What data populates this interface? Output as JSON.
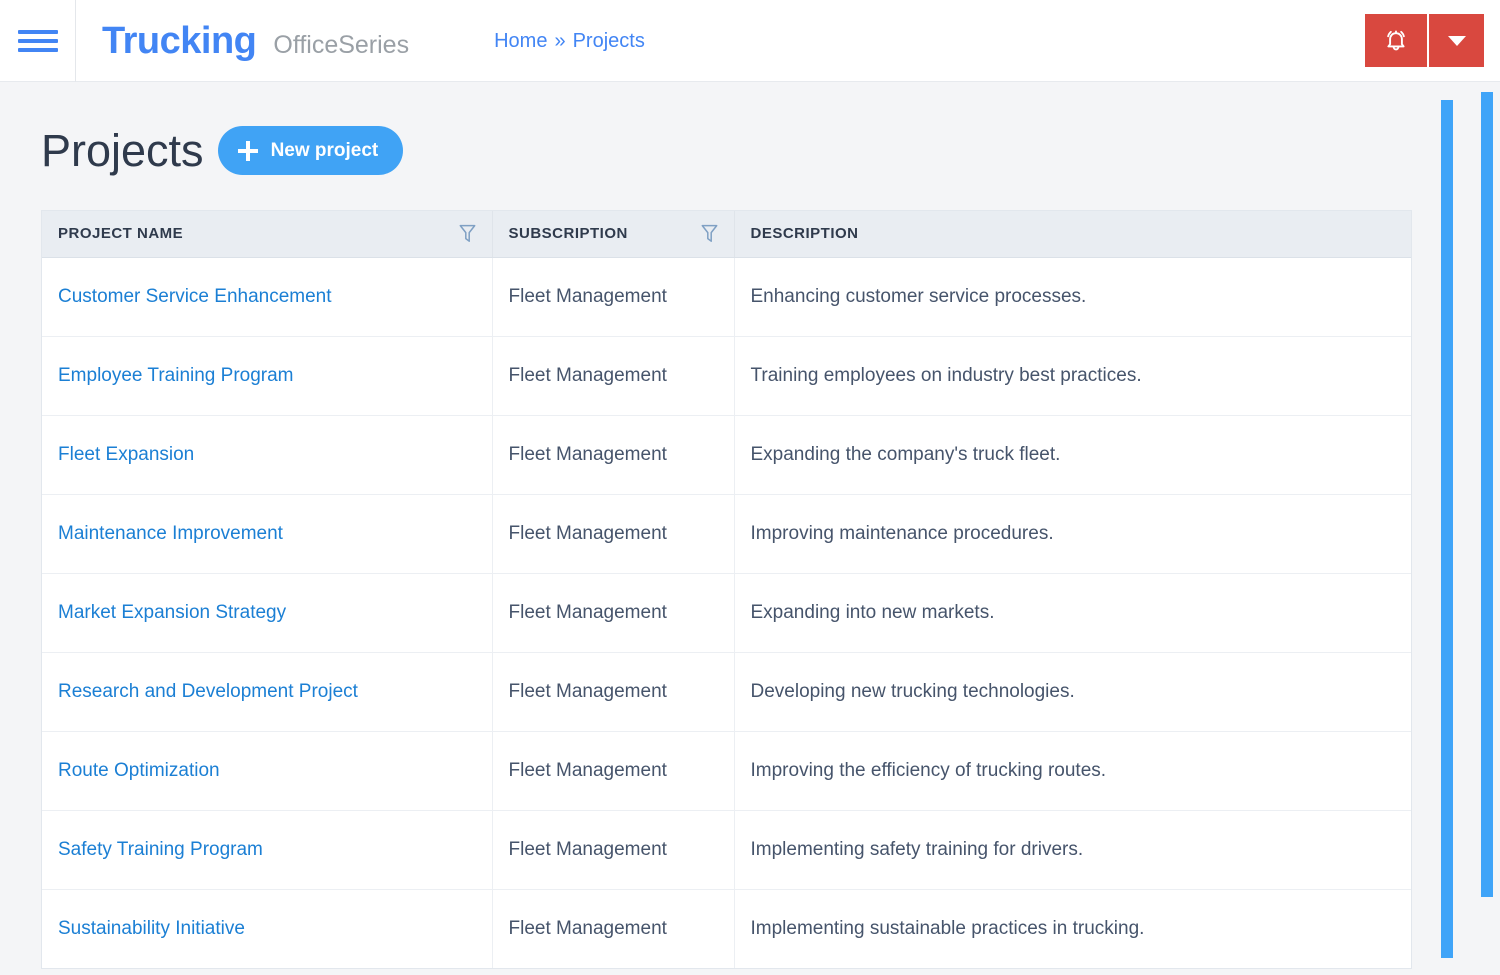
{
  "navbar": {
    "menu_icon": "hamburger-icon",
    "brand": "Trucking",
    "brand_sub": "OfficeSeries",
    "breadcrumb": {
      "home": "Home",
      "separator": "»",
      "current": "Projects"
    },
    "notification_icon": "bell-icon",
    "dropdown_icon": "chevron-down-icon",
    "accent_red": "#d9483f",
    "accent_blue": "#4285f4"
  },
  "page": {
    "title": "Projects",
    "new_project_label": "New project",
    "new_project_icon": "plus-icon",
    "primary_button_color": "#40a3f5"
  },
  "table": {
    "columns": [
      {
        "label": "PROJECT NAME",
        "filter_icon": "filter-icon",
        "filterable": true
      },
      {
        "label": "SUBSCRIPTION",
        "filter_icon": "filter-icon",
        "filterable": true
      },
      {
        "label": "DESCRIPTION",
        "filterable": false
      }
    ],
    "rows": [
      {
        "name": "Customer Service Enhancement",
        "subscription": "Fleet Management",
        "description": "Enhancing customer service processes."
      },
      {
        "name": "Employee Training Program",
        "subscription": "Fleet Management",
        "description": "Training employees on industry best practices."
      },
      {
        "name": "Fleet Expansion",
        "subscription": "Fleet Management",
        "description": "Expanding the company's truck fleet."
      },
      {
        "name": "Maintenance Improvement",
        "subscription": "Fleet Management",
        "description": "Improving maintenance procedures."
      },
      {
        "name": "Market Expansion Strategy",
        "subscription": "Fleet Management",
        "description": "Expanding into new markets."
      },
      {
        "name": "Research and Development Project",
        "subscription": "Fleet Management",
        "description": "Developing new trucking technologies."
      },
      {
        "name": "Route Optimization",
        "subscription": "Fleet Management",
        "description": "Improving the efficiency of trucking routes."
      },
      {
        "name": "Safety Training Program",
        "subscription": "Fleet Management",
        "description": "Implementing safety training for drivers."
      },
      {
        "name": "Sustainability Initiative",
        "subscription": "Fleet Management",
        "description": "Implementing sustainable practices in trucking."
      }
    ]
  },
  "scrollbars": {
    "inner_color": "#3fa4f8",
    "outer_color": "#3fa4f8"
  }
}
